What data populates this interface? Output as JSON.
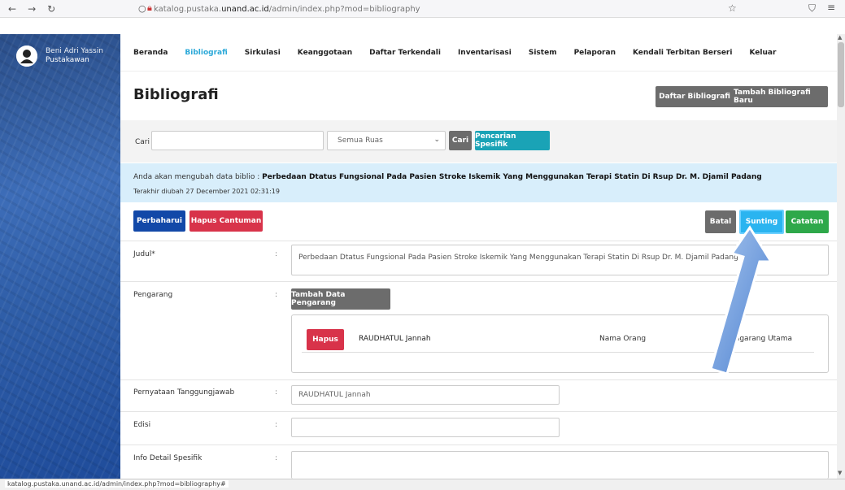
{
  "browser": {
    "url_prefix": "katalog.pustaka.",
    "url_host": "unand.ac.id",
    "url_path": "/admin/index.php?mod=bibliography"
  },
  "user": {
    "name": "Beni Adri Yassin",
    "role": "Pustakawan"
  },
  "nav": [
    "Beranda",
    "Bibliografi",
    "Sirkulasi",
    "Keanggotaan",
    "Daftar Terkendali",
    "Inventarisasi",
    "Sistem",
    "Pelaporan",
    "Kendali Terbitan Berseri",
    "Keluar"
  ],
  "nav_active": "Bibliografi",
  "page": {
    "title": "Bibliografi",
    "btn_list": "Daftar Bibliografi",
    "btn_add": "Tambah Bibliografi Baru"
  },
  "search": {
    "label": "Cari",
    "input_value": "",
    "field_select": "Semua Ruas",
    "btn_search": "Cari",
    "btn_advanced": "Pencarian Spesifik"
  },
  "notice": {
    "prefix": "Anda akan mengubah data biblio : ",
    "title": "Perbedaan Dtatus Fungsional Pada Pasien Stroke Iskemik Yang Menggunakan Terapi Statin Di Rsup Dr. M. Djamil Padang",
    "last_modified": "Terakhir diubah 27 December 2021 02:31:19"
  },
  "actions": {
    "update": "Perbaharui",
    "delete": "Hapus Cantuman",
    "cancel": "Batal",
    "edit": "Sunting",
    "notes": "Catatan"
  },
  "form": {
    "title_label": "Judul*",
    "title_value": "Perbedaan Dtatus Fungsional Pada Pasien Stroke Iskemik Yang Menggunakan Terapi Statin Di Rsup Dr. M. Djamil Padang",
    "author_label": "Pengarang",
    "add_author": "Tambah Data Pengarang",
    "author": {
      "delete": "Hapus",
      "name": "RAUDHATUL Jannah",
      "type": "Nama Orang",
      "role": "Pengarang Utama"
    },
    "responsibility_label": "Pernyataan Tanggungjawab",
    "responsibility_value": "RAUDHATUL Jannah",
    "edition_label": "Edisi",
    "edition_value": "",
    "spec_label": "Info Detail Spesifik",
    "spec_value": ""
  },
  "colon": ":",
  "statusbar": "katalog.pustaka.unand.ac.id/admin/index.php?mod=bibliography#",
  "colors": {
    "accent": "#2aa8d8",
    "primary": "#1248a8",
    "danger": "#d8334a",
    "success": "#2ea84a"
  }
}
